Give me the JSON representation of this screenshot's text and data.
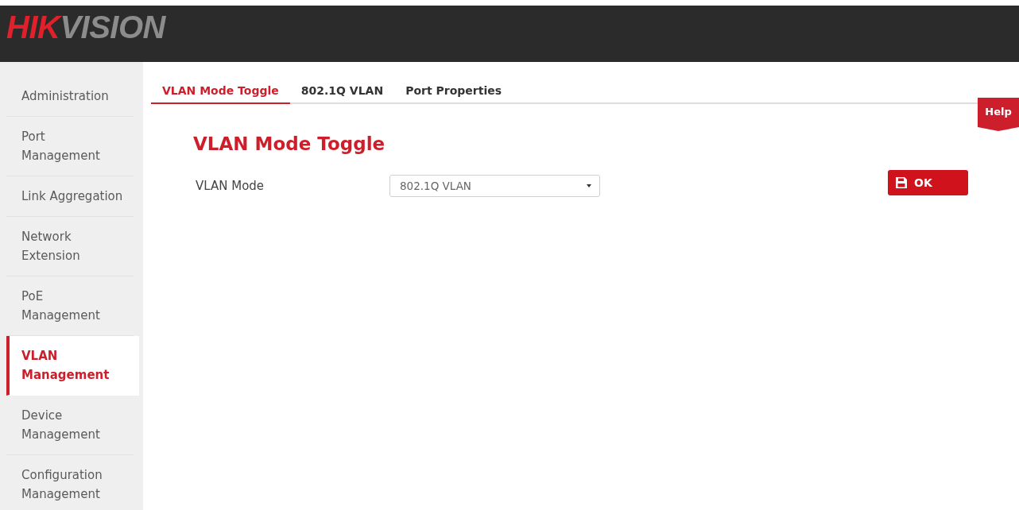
{
  "header": {
    "logo": [
      "HIK",
      "VISION"
    ]
  },
  "sidebar": {
    "items": [
      {
        "label": "Administration",
        "selected": false
      },
      {
        "label": "Port Management",
        "selected": false
      },
      {
        "label": "Link Aggregation",
        "selected": false
      },
      {
        "label": "Network Extension",
        "selected": false
      },
      {
        "label": "PoE Management",
        "selected": false
      },
      {
        "label": "VLAN Management",
        "selected": true
      },
      {
        "label": "Device Management",
        "selected": false
      },
      {
        "label": "Configuration Management",
        "selected": false
      }
    ]
  },
  "tabs": [
    {
      "label": "VLAN Mode Toggle",
      "selected": true
    },
    {
      "label": "802.1Q VLAN",
      "selected": false
    },
    {
      "label": "Port Properties",
      "selected": false
    }
  ],
  "help": {
    "label": "Help"
  },
  "section": {
    "title": "VLAN Mode Toggle",
    "fields": [
      {
        "label": "VLAN Mode",
        "value": "802.1Q VLAN"
      }
    ]
  },
  "buttons": [
    {
      "label": "OK"
    }
  ]
}
